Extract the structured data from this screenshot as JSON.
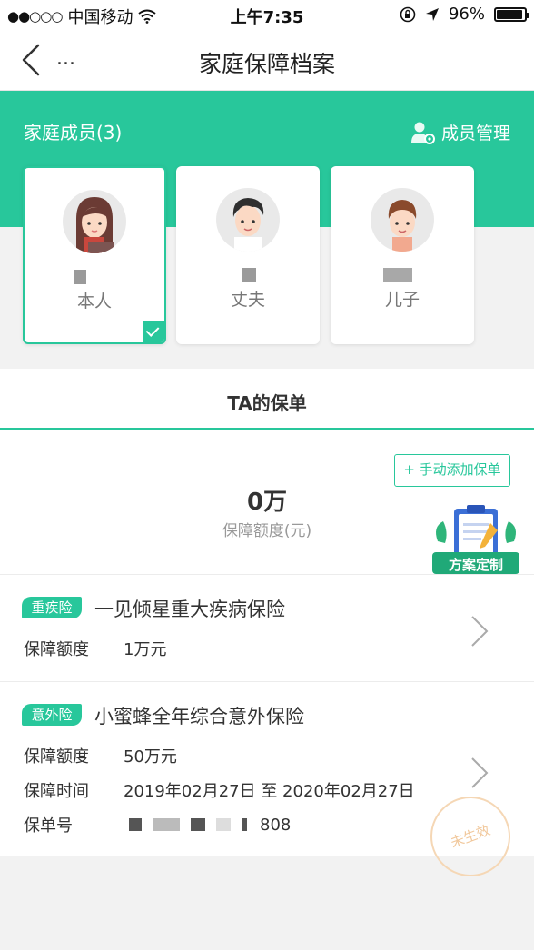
{
  "status_bar": {
    "signal": "●●○○○",
    "carrier": "中国移动",
    "time": "上午7:35",
    "battery": "96%"
  },
  "nav": {
    "more": "...",
    "title": "家庭保障档案"
  },
  "family": {
    "title": "家庭成员(3)",
    "manage_label": "成员管理",
    "members": [
      {
        "label": "本人",
        "selected": true
      },
      {
        "label": "丈夫",
        "selected": false
      },
      {
        "label": "儿子",
        "selected": false
      }
    ]
  },
  "policies_section": {
    "title": "TA的保单",
    "add_button": "+ 手动添加保单",
    "total_amount": "0万",
    "total_label": "保障额度(元)",
    "plan_badge": "方案定制"
  },
  "policies": [
    {
      "tag": "重疾险",
      "name": "一见倾星重大疾病保险",
      "fields": [
        {
          "key": "保障额度",
          "value": "1万元"
        }
      ]
    },
    {
      "tag": "意外险",
      "name": "小蜜蜂全年综合意外保险",
      "fields": [
        {
          "key": "保障额度",
          "value": "50万元"
        },
        {
          "key": "保障时间",
          "value": "2019年02月27日 至 2020年02月27日"
        },
        {
          "key": "保单号",
          "value": "808"
        }
      ],
      "stamp": "未生效"
    }
  ],
  "colors": {
    "accent": "#28c79b",
    "background": "#f2f2f2"
  }
}
